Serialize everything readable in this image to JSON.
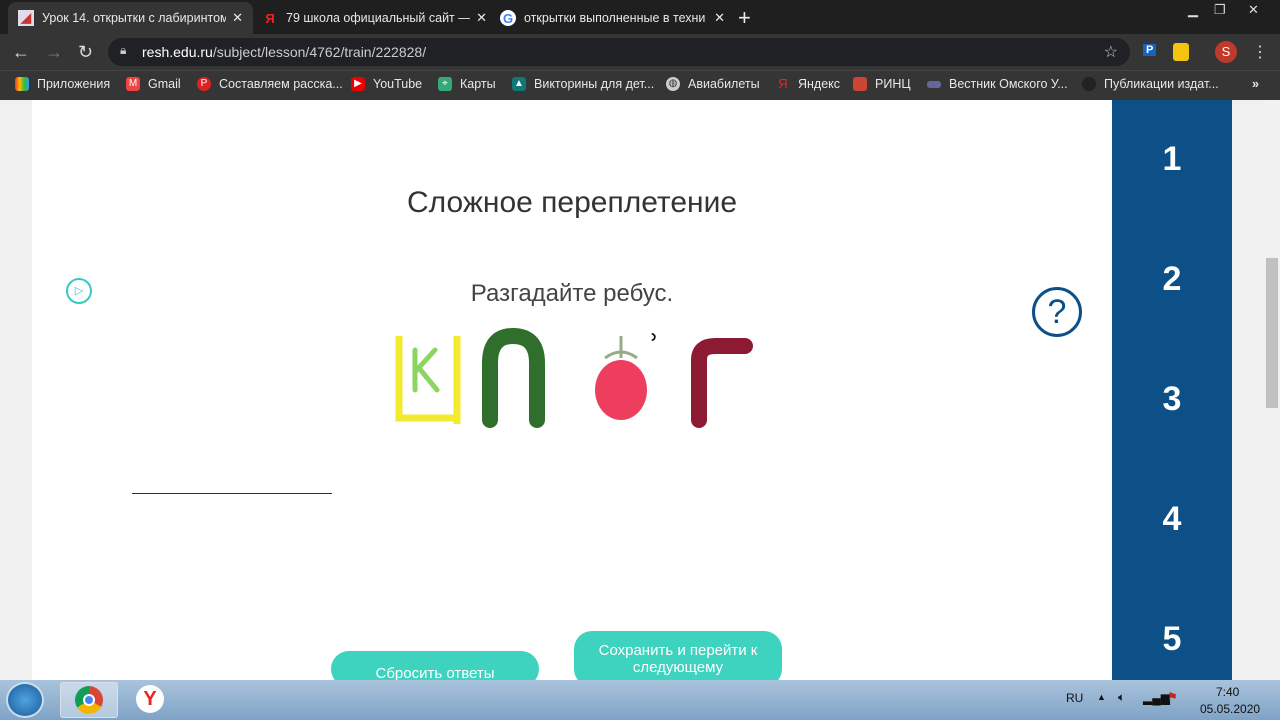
{
  "browser": {
    "tabs": [
      {
        "title": "Урок 14. открытки с лабиринтом",
        "icon": "resh-icon",
        "active": true
      },
      {
        "title": "79 школа официальный сайт —",
        "icon": "yandex-icon",
        "active": false
      },
      {
        "title": "открытки выполненные в техни",
        "icon": "google-icon",
        "active": false
      }
    ],
    "url_host": "resh.edu.ru",
    "url_path": "/subject/lesson/4762/train/222828/",
    "profile_initial": "S",
    "bookmarks": [
      "Приложения",
      "Gmail",
      "Составляем расска...",
      "YouTube",
      "Карты",
      "Викторины для дет...",
      "Авиабилеты",
      "Яндекс",
      "РИНЦ",
      "Вестник Омского У...",
      "Публикации издат..."
    ]
  },
  "page": {
    "title": "Сложное переплетение",
    "task": "Разгадайте ребус.",
    "answer_value": "",
    "reset_label": "Сбросить ответы",
    "save_label": "Сохранить и перейти к следующему",
    "sidebar_numbers": [
      "1",
      "2",
      "3",
      "4",
      "5"
    ],
    "colors": {
      "accent": "#3dd3bf",
      "sidebar": "#0d4f87"
    }
  },
  "taskbar": {
    "lang": "RU",
    "time": "7:40",
    "date": "05.05.2020"
  }
}
